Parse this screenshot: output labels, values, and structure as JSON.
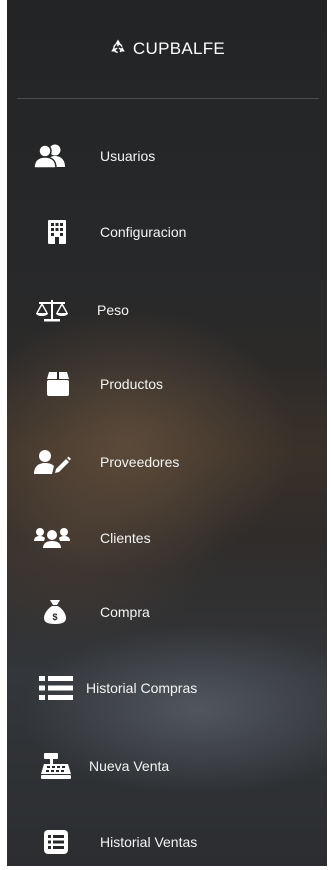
{
  "brand": {
    "name": "CUPBALFE",
    "icon": "recycle-icon"
  },
  "menu": [
    {
      "label": "Usuarios",
      "icon": "users-icon"
    },
    {
      "label": "Configuracion",
      "icon": "building-icon"
    },
    {
      "label": "Peso",
      "icon": "balance-scale-icon"
    },
    {
      "label": "Productos",
      "icon": "box-icon"
    },
    {
      "label": "Proveedores",
      "icon": "user-edit-icon"
    },
    {
      "label": "Clientes",
      "icon": "user-group-icon"
    },
    {
      "label": "Compra",
      "icon": "money-bag-icon"
    },
    {
      "label": "Historial Compras",
      "icon": "list-icon"
    },
    {
      "label": "Nueva Venta",
      "icon": "cash-register-icon"
    },
    {
      "label": "Historial Ventas",
      "icon": "table-list-icon"
    }
  ],
  "colors": {
    "text": "#ffffff",
    "background": "#26282a"
  }
}
